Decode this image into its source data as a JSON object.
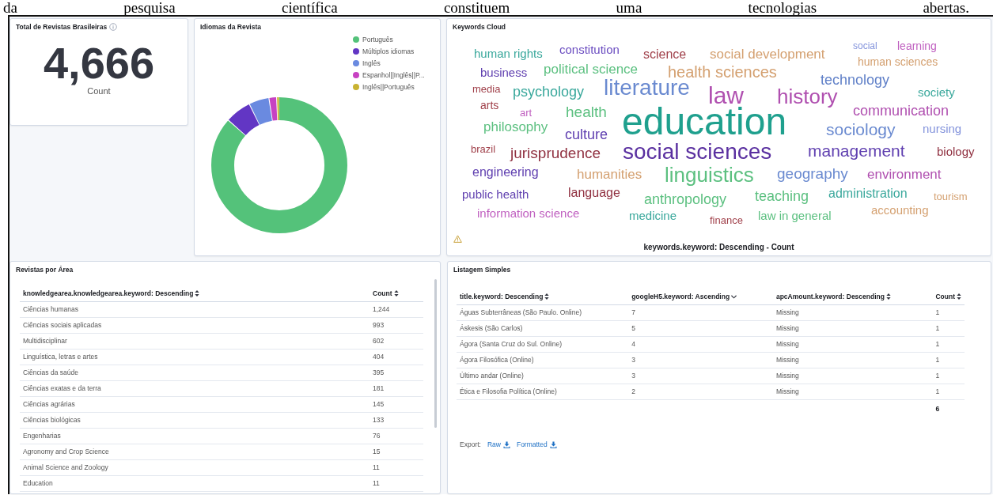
{
  "document_text": "da pesquisa científica constituem uma tecnologias abertas.",
  "metric_panel": {
    "title": "Total de Revistas Brasileiras",
    "value": "4,666",
    "label": "Count"
  },
  "languages_panel": {
    "title": "Idiomas da Revista",
    "legend": [
      {
        "label": "Português",
        "color": "#54c27a"
      },
      {
        "label": "Múltiplos idiomas",
        "color": "#6236c4"
      },
      {
        "label": "Inglês",
        "color": "#6a8ae0"
      },
      {
        "label": "Espanhol||Inglês||P...",
        "color": "#c742c2"
      },
      {
        "label": "Inglês||Português",
        "color": "#c9b332"
      }
    ]
  },
  "keywords_panel": {
    "title": "Keywords Cloud",
    "footer": "keywords.keyword: Descending - Count",
    "words": [
      {
        "text": "human rights",
        "color": "#3aa89c"
      },
      {
        "text": "constitution",
        "color": "#6a4cc0"
      },
      {
        "text": "science",
        "color": "#a0404a"
      },
      {
        "text": "social development",
        "color": "#d4a070"
      },
      {
        "text": "social",
        "color": "#8494dc"
      },
      {
        "text": "learning",
        "color": "#c060c0"
      },
      {
        "text": "human sciences",
        "color": "#d4a070"
      },
      {
        "text": "business",
        "color": "#6040b0"
      },
      {
        "text": "political science",
        "color": "#5cc080"
      },
      {
        "text": "health sciences",
        "color": "#d4a070"
      },
      {
        "text": "technology",
        "color": "#6080c8"
      },
      {
        "text": "media",
        "color": "#a0404a"
      },
      {
        "text": "psychology",
        "color": "#3aa89c"
      },
      {
        "text": "literature",
        "color": "#6a8ad0"
      },
      {
        "text": "law",
        "color": "#b050b0"
      },
      {
        "text": "history",
        "color": "#b050b0"
      },
      {
        "text": "society",
        "color": "#3aa89c"
      },
      {
        "text": "arts",
        "color": "#a0404a"
      },
      {
        "text": "art",
        "color": "#c060c0"
      },
      {
        "text": "health",
        "color": "#5cc080"
      },
      {
        "text": "communication",
        "color": "#b050b0"
      },
      {
        "text": "philosophy",
        "color": "#5cc080"
      },
      {
        "text": "culture",
        "color": "#6040b0"
      },
      {
        "text": "education",
        "color": "#1fa08e"
      },
      {
        "text": "sociology",
        "color": "#6a8ad0"
      },
      {
        "text": "nursing",
        "color": "#8494dc"
      },
      {
        "text": "brazil",
        "color": "#a0404a"
      },
      {
        "text": "jurisprudence",
        "color": "#903040"
      },
      {
        "text": "social sciences",
        "color": "#5a30a0"
      },
      {
        "text": "management",
        "color": "#6040b0"
      },
      {
        "text": "biology",
        "color": "#903040"
      },
      {
        "text": "engineering",
        "color": "#6040b0"
      },
      {
        "text": "humanities",
        "color": "#d4a070"
      },
      {
        "text": "linguistics",
        "color": "#5cc080"
      },
      {
        "text": "geography",
        "color": "#6a8ad0"
      },
      {
        "text": "environment",
        "color": "#b050b0"
      },
      {
        "text": "public health",
        "color": "#6040b0"
      },
      {
        "text": "language",
        "color": "#903040"
      },
      {
        "text": "anthropology",
        "color": "#5cc080"
      },
      {
        "text": "teaching",
        "color": "#5cc080"
      },
      {
        "text": "administration",
        "color": "#3aa89c"
      },
      {
        "text": "tourism",
        "color": "#d4a070"
      },
      {
        "text": "information science",
        "color": "#c060c0"
      },
      {
        "text": "medicine",
        "color": "#3aa89c"
      },
      {
        "text": "finance",
        "color": "#a0404a"
      },
      {
        "text": "law in general",
        "color": "#5cc080"
      },
      {
        "text": "accounting",
        "color": "#d4a070"
      }
    ]
  },
  "area_panel": {
    "title": "Revistas por Área",
    "columns": [
      {
        "label": "knowledgearea.knowledgearea.keyword: Descending",
        "sorted": false
      },
      {
        "label": "Count",
        "sorted": false
      }
    ],
    "rows": [
      [
        "Ciências humanas",
        "1,244"
      ],
      [
        "Ciências sociais aplicadas",
        "993"
      ],
      [
        "Multidisciplinar",
        "602"
      ],
      [
        "Linguística, letras e artes",
        "404"
      ],
      [
        "Ciências da saúde",
        "395"
      ],
      [
        "Ciências exatas e da terra",
        "181"
      ],
      [
        "Ciências agrárias",
        "145"
      ],
      [
        "Ciências biológicas",
        "133"
      ],
      [
        "Engenharias",
        "76"
      ],
      [
        "Agronomy and Crop Science",
        "15"
      ],
      [
        "Animal Science and Zoology",
        "11"
      ],
      [
        "Education",
        "11"
      ]
    ]
  },
  "listing_panel": {
    "title": "Listagem Simples",
    "columns": [
      {
        "label": "title.keyword: Descending",
        "sorted": false
      },
      {
        "label": "googleH5.keyword: Ascending",
        "sorted": true
      },
      {
        "label": "apcAmount.keyword: Descending",
        "sorted": false
      },
      {
        "label": "Count",
        "sorted": false
      }
    ],
    "rows": [
      [
        "Águas Subterrâneas (São Paulo. Online)",
        "7",
        "Missing",
        "1"
      ],
      [
        "Áskesis (São Carlos)",
        "5",
        "Missing",
        "1"
      ],
      [
        "Ágora (Santa Cruz do Sul. Online)",
        "4",
        "Missing",
        "1"
      ],
      [
        "Ágora Filosófica (Online)",
        "3",
        "Missing",
        "1"
      ],
      [
        "Último andar (Online)",
        "3",
        "Missing",
        "1"
      ],
      [
        "Ética e Filosofia Política (Online)",
        "2",
        "Missing",
        "1"
      ]
    ],
    "total": "6",
    "export_label": "Export:",
    "export_links": [
      "Raw",
      "Formatted"
    ]
  }
}
